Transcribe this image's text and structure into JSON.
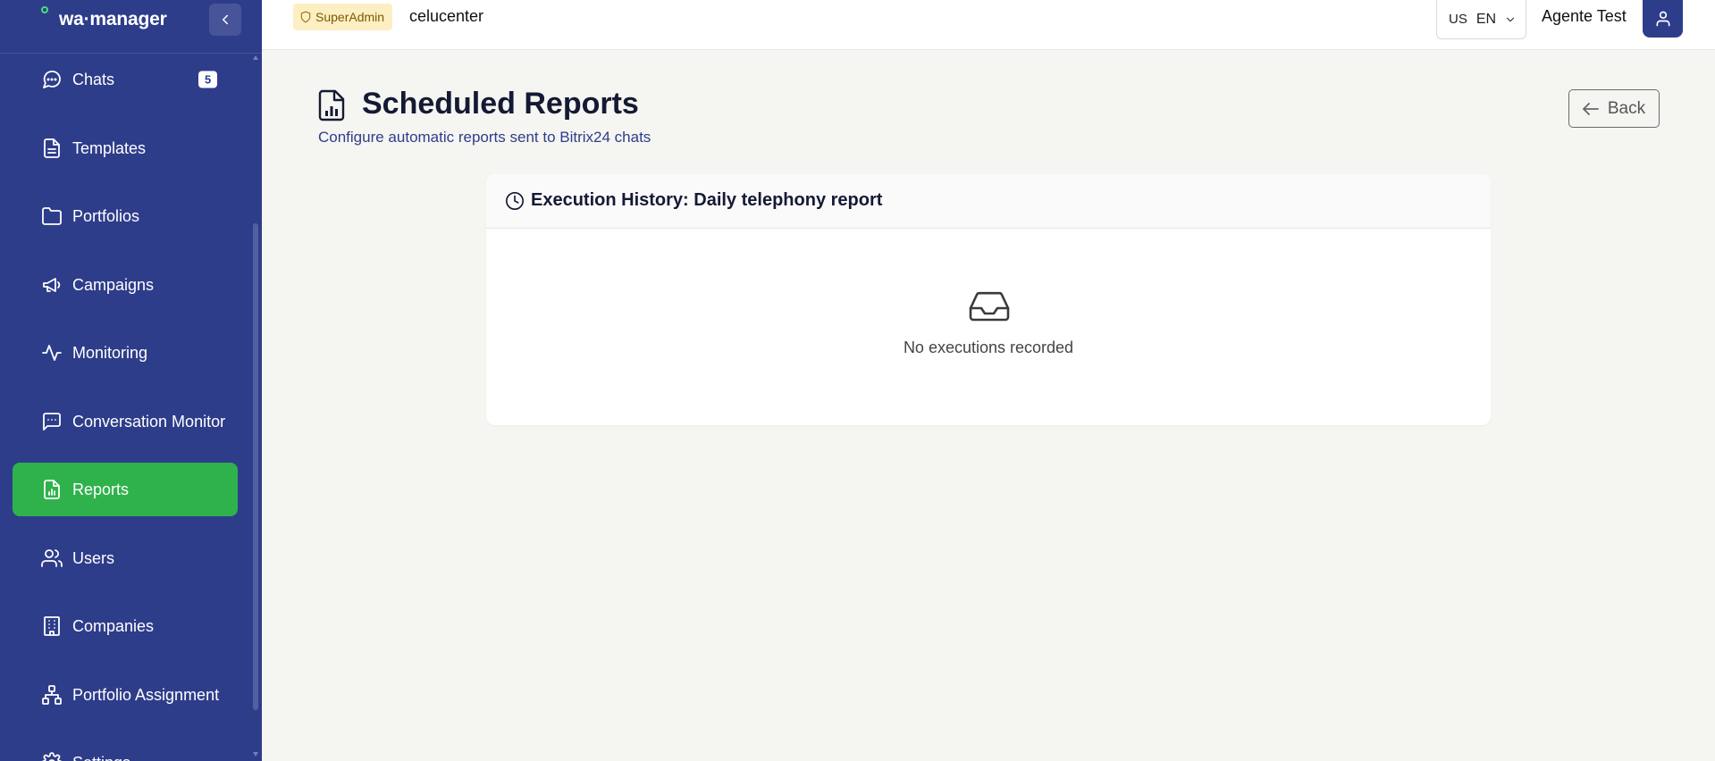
{
  "app": {
    "logo": "wa·manager"
  },
  "sidebar": {
    "items": [
      {
        "label": "Chats",
        "icon": "chat-icon",
        "badge": "5",
        "active": false
      },
      {
        "label": "Templates",
        "icon": "document-icon",
        "active": false
      },
      {
        "label": "Portfolios",
        "icon": "folder-icon",
        "active": false
      },
      {
        "label": "Campaigns",
        "icon": "megaphone-icon",
        "active": false
      },
      {
        "label": "Monitoring",
        "icon": "activity-icon",
        "active": false
      },
      {
        "label": "Conversation Monitor",
        "icon": "message-square-icon",
        "active": false
      },
      {
        "label": "Reports",
        "icon": "report-icon",
        "active": true
      },
      {
        "label": "Users",
        "icon": "users-icon",
        "active": false
      },
      {
        "label": "Companies",
        "icon": "building-icon",
        "active": false
      },
      {
        "label": "Portfolio Assignment",
        "icon": "network-icon",
        "active": false
      },
      {
        "label": "Settings",
        "icon": "settings-icon",
        "active": false
      }
    ]
  },
  "topbar": {
    "role": "SuperAdmin",
    "company": "celucenter",
    "language": {
      "flag": "US",
      "code": "EN"
    },
    "user": "Agente Test"
  },
  "page": {
    "title": "Scheduled Reports",
    "subtitle": "Configure automatic reports sent to Bitrix24 chats",
    "back_label": "Back"
  },
  "card": {
    "title": "Execution History: Daily telephony report",
    "empty_text": "No executions recorded"
  },
  "colors": {
    "sidebar": "#2e3d8a",
    "active": "#2fb24c",
    "background": "#f5f5f1"
  }
}
